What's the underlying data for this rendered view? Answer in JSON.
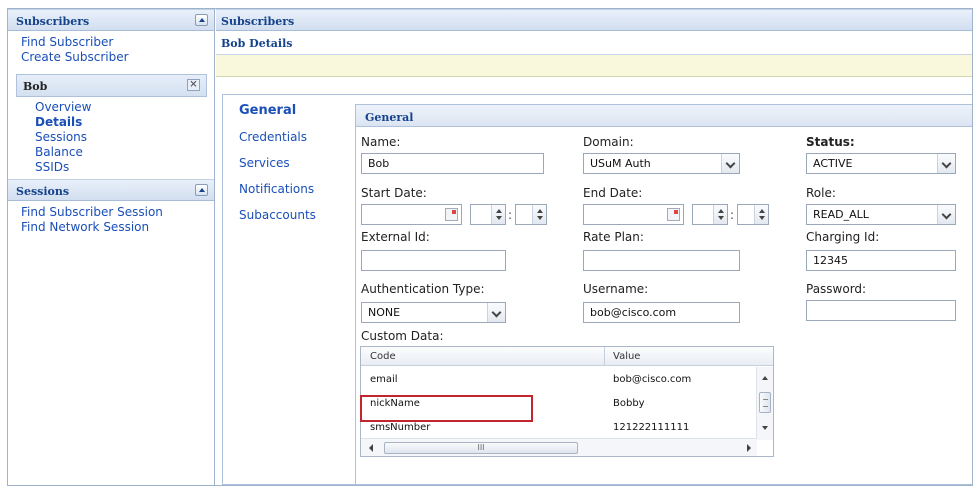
{
  "sidebar": {
    "subscribers_panel": {
      "title": "Subscribers",
      "links": [
        "Find Subscriber",
        "Create Subscriber"
      ]
    },
    "subscriber_box": {
      "name": "Bob",
      "close": "×"
    },
    "subscriber_links": [
      "Overview",
      "Details",
      "Sessions",
      "Balance",
      "SSIDs"
    ],
    "sessions_panel": {
      "title": "Sessions",
      "links": [
        "Find Subscriber Session",
        "Find Network Session"
      ]
    }
  },
  "main": {
    "title": "Subscribers",
    "subtitle": "Bob Details",
    "tabs": [
      "General",
      "Credentials",
      "Services",
      "Notifications",
      "Subaccounts"
    ],
    "section_title": "General"
  },
  "form": {
    "name_label": "Name:",
    "name_value": "Bob",
    "domain_label": "Domain:",
    "domain_value": "USuM Auth",
    "status_label": "Status:",
    "status_value": "ACTIVE",
    "start_date_label": "Start Date:",
    "end_date_label": "End Date:",
    "role_label": "Role:",
    "role_value": "READ_ALL",
    "external_id_label": "External Id:",
    "external_id_value": "",
    "rate_plan_label": "Rate Plan:",
    "rate_plan_value": "",
    "charging_id_label": "Charging Id:",
    "charging_id_value": "12345",
    "auth_type_label": "Authentication Type:",
    "auth_type_value": "NONE",
    "username_label": "Username:",
    "username_value": "bob@cisco.com",
    "password_label": "Password:",
    "password_value": "",
    "time_separator": ":"
  },
  "custom_data": {
    "label": "Custom Data:",
    "columns": [
      "Code",
      "Value"
    ],
    "rows": [
      {
        "code": "email",
        "value": "bob@cisco.com"
      },
      {
        "code": "nickName",
        "value": "Bobby"
      },
      {
        "code": "smsNumber",
        "value": "121222111111"
      }
    ],
    "hscroll_grip": "III"
  },
  "colors": {
    "link": "#1a4fb8",
    "panel_title": "#15428b",
    "highlight_border": "#c0262d",
    "info_bar": "#f9f8dd"
  }
}
